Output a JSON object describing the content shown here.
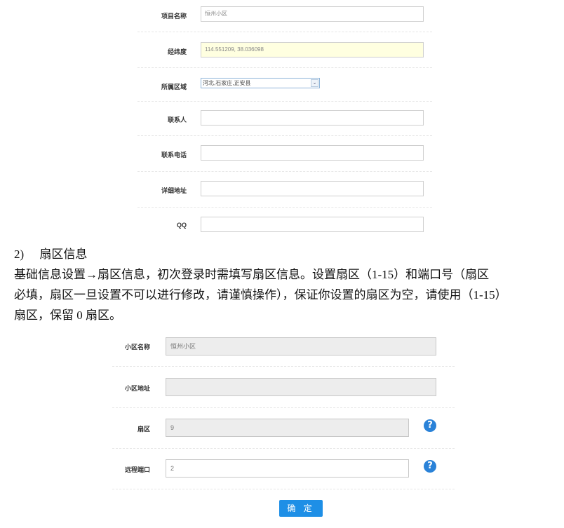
{
  "form1": {
    "project_name_label": "项目名称",
    "project_name_value": "恒州小区",
    "latlng_label": "经纬度",
    "latlng_value": "114.551209,   38.036098",
    "region_label": "所属区域",
    "region_value": "河北,石家庄,正安县",
    "contact_label": "联系人",
    "contact_value": "",
    "phone_label": "联系电话",
    "phone_value": "",
    "address_label": "详细地址",
    "address_value": "",
    "qq_label": "QQ",
    "qq_value": ""
  },
  "doc": {
    "heading_num": "2)",
    "heading_text": "扇区信息",
    "paragraph_line1": "基础信息设置→扇区信息，初次登录时需填写扇区信息。设置扇区（1-15）和端口号（扇区",
    "paragraph_line2": "必填，扇区一旦设置不可以进行修改，请谨慎操作），保证你设置的扇区为空，请使用（1-15）",
    "paragraph_line3": "扇区，保留 0 扇区。"
  },
  "form2": {
    "community_name_label": "小区名称",
    "community_name_value": "恒州小区",
    "community_address_label": "小区地址",
    "community_address_value": "",
    "sector_label": "扇区",
    "sector_value": "9",
    "remote_port_label": "远程端口",
    "remote_port_value": "2",
    "help_glyph": "?",
    "confirm_label": "确 定"
  },
  "colors": {
    "confirm_button": "#1e8fe6",
    "help_icon": "#2a82d8",
    "readonly_input": "#ededed",
    "highlight_input": "#ffffe0"
  }
}
